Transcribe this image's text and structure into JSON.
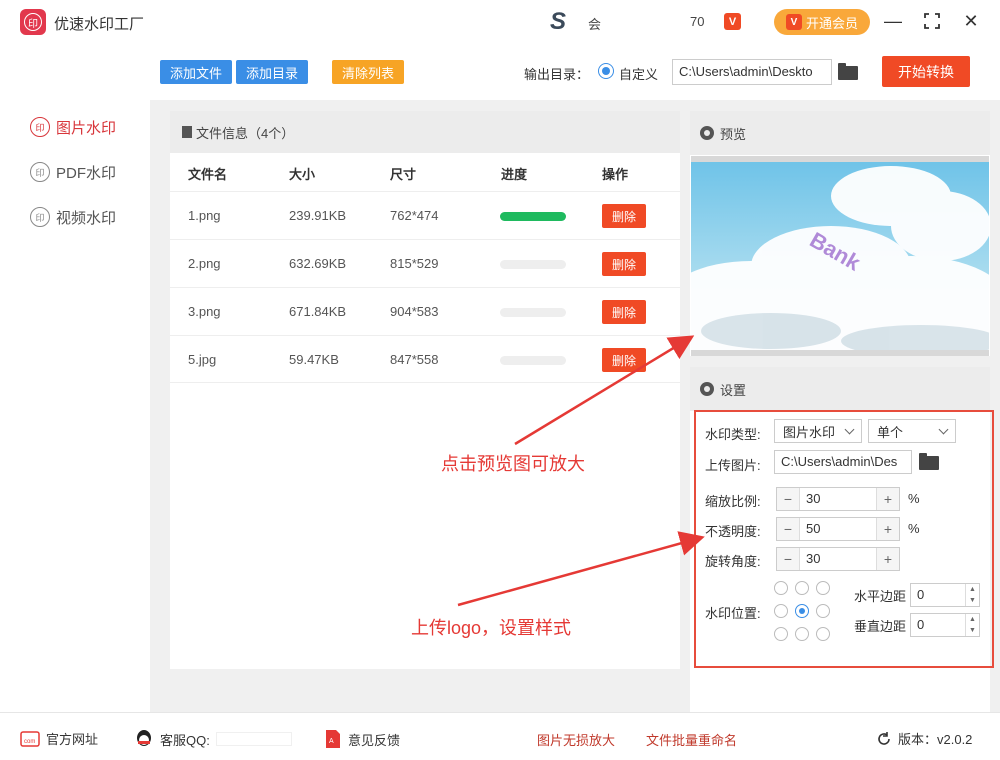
{
  "app": {
    "title": "优速水印工厂",
    "logo_text": "印"
  },
  "titlebar": {
    "s_text": "会",
    "num": "70",
    "badge": "V",
    "vip_label": "开通会员",
    "vip_icon": "V"
  },
  "nav": {
    "items": [
      {
        "label": "图片水印",
        "icon": "印"
      },
      {
        "label": "PDF水印",
        "icon": "印"
      },
      {
        "label": "视频水印",
        "icon": "印"
      }
    ]
  },
  "toolbar": {
    "add_file": "添加文件",
    "add_dir": "添加目录",
    "clear_list": "清除列表",
    "output_label": "输出目录：",
    "custom_label": "自定义",
    "output_path": "C:\\Users\\admin\\Deskto",
    "start": "开始转换"
  },
  "files": {
    "header": "文件信息（4个）",
    "columns": [
      "文件名",
      "大小",
      "尺寸",
      "进度",
      "操作"
    ],
    "rows": [
      {
        "name": "1.png",
        "size": "239.91KB",
        "dim": "762*474",
        "progress": 1.0,
        "action": "删除"
      },
      {
        "name": "2.png",
        "size": "632.69KB",
        "dim": "815*529",
        "progress": 0.0,
        "action": "删除"
      },
      {
        "name": "3.png",
        "size": "671.84KB",
        "dim": "904*583",
        "progress": 0.0,
        "action": "删除"
      },
      {
        "name": "5.jpg",
        "size": "59.47KB",
        "dim": "847*558",
        "progress": 0.0,
        "action": "删除"
      }
    ]
  },
  "preview": {
    "title": "预览",
    "watermark_text": "Bank"
  },
  "settings": {
    "title": "设置",
    "type_label": "水印类型:",
    "type_value": "图片水印",
    "mode_value": "单个",
    "upload_label": "上传图片:",
    "upload_path": "C:\\Users\\admin\\Des",
    "scale_label": "缩放比例:",
    "scale_value": "30",
    "opacity_label": "不透明度:",
    "opacity_value": "50",
    "rotate_label": "旋转角度:",
    "rotate_value": "30",
    "percent": "%",
    "position_label": "水印位置:",
    "h_margin_label": "水平边距",
    "h_margin_value": "0",
    "v_margin_label": "垂直边距",
    "v_margin_value": "0"
  },
  "annotations": {
    "preview_hint": "点击预览图可放大",
    "upload_hint": "上传logo，设置样式"
  },
  "footer": {
    "website": "官方网址",
    "qq": "客服QQ:",
    "feedback": "意见反馈",
    "link1": "图片无损放大",
    "link2": "文件批量重命名",
    "version": "版本：v2.0.2"
  },
  "colors": {
    "accent_red": "#f04a25",
    "accent_blue": "#3a8ee6",
    "accent_orange": "#f7a425",
    "progress_green": "#1fba5f"
  }
}
